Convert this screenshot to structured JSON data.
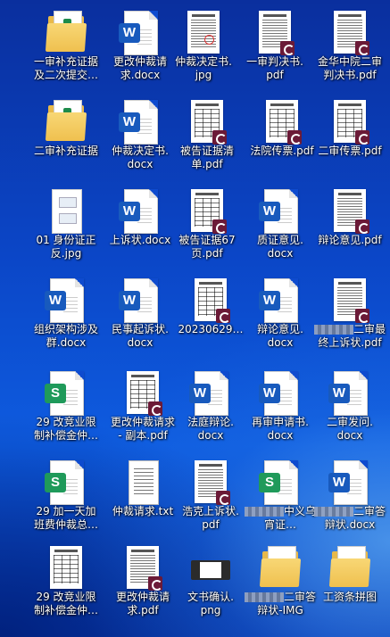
{
  "desktop": {
    "icons": [
      {
        "label": "一审补充证据\n及二次提交…",
        "type": "folder"
      },
      {
        "label": "更改仲裁请\n求.docx",
        "type": "word"
      },
      {
        "label": "仲裁决定书.\njpg",
        "type": "scan-text"
      },
      {
        "label": "一审判决书.\npdf",
        "type": "scan-pdf"
      },
      {
        "label": "金华中院二审\n判决书.pdf",
        "type": "scan-pdf"
      },
      {
        "label": "二审补充证据",
        "type": "folder"
      },
      {
        "label": "仲裁决定书.\ndocx",
        "type": "word"
      },
      {
        "label": "被告证据清\n单.pdf",
        "type": "table-pdf"
      },
      {
        "label": "法院传票.pdf",
        "type": "table-pdf"
      },
      {
        "label": "二审传票.pdf",
        "type": "table-pdf"
      },
      {
        "label": "01 身份证正\n反.jpg",
        "type": "idcard"
      },
      {
        "label": "上诉状.docx",
        "type": "word"
      },
      {
        "label": "被告证据67\n页.pdf",
        "type": "table-pdf"
      },
      {
        "label": "质证意见.\ndocx",
        "type": "word"
      },
      {
        "label": "辩论意见.pdf",
        "type": "scan-pdf"
      },
      {
        "label": "组织架构涉及\n群.docx",
        "type": "word"
      },
      {
        "label": "民事起诉状.\ndocx",
        "type": "word"
      },
      {
        "label": "20230629…",
        "type": "table-pdf"
      },
      {
        "label": "辩论意见.\ndocx",
        "type": "word"
      },
      {
        "label": "二审最\n终上诉状.pdf",
        "type": "scan-pdf",
        "redacted": true
      },
      {
        "label": "29 改竞业限\n制补偿金仲…",
        "type": "sheet"
      },
      {
        "label": "更改仲裁请求\n- 副本.pdf",
        "type": "table-pdf"
      },
      {
        "label": "法庭辩论.\ndocx",
        "type": "word"
      },
      {
        "label": "再审申请书.\ndocx",
        "type": "word"
      },
      {
        "label": "二审发问.\ndocx",
        "type": "word"
      },
      {
        "label": "29 加一天加\n班费仲裁总…",
        "type": "sheet"
      },
      {
        "label": "仲裁请求.txt",
        "type": "txt"
      },
      {
        "label": "浩克上诉状.\npdf",
        "type": "scan-pdf"
      },
      {
        "label": "中义乌\n宵证…",
        "type": "sheet",
        "redacted": true
      },
      {
        "label": "二审答\n辩状.docx",
        "type": "word",
        "redacted": true
      },
      {
        "label": "29 改竞业限\n制补偿金仲…",
        "type": "table-plain"
      },
      {
        "label": "更改仲裁请\n求.pdf",
        "type": "scan-pdf"
      },
      {
        "label": "文书确认.\npng",
        "type": "png"
      },
      {
        "label": "二审答\n辩状-IMG",
        "type": "folder",
        "redacted": true
      },
      {
        "label": "工资条拼图",
        "type": "folder"
      }
    ]
  }
}
